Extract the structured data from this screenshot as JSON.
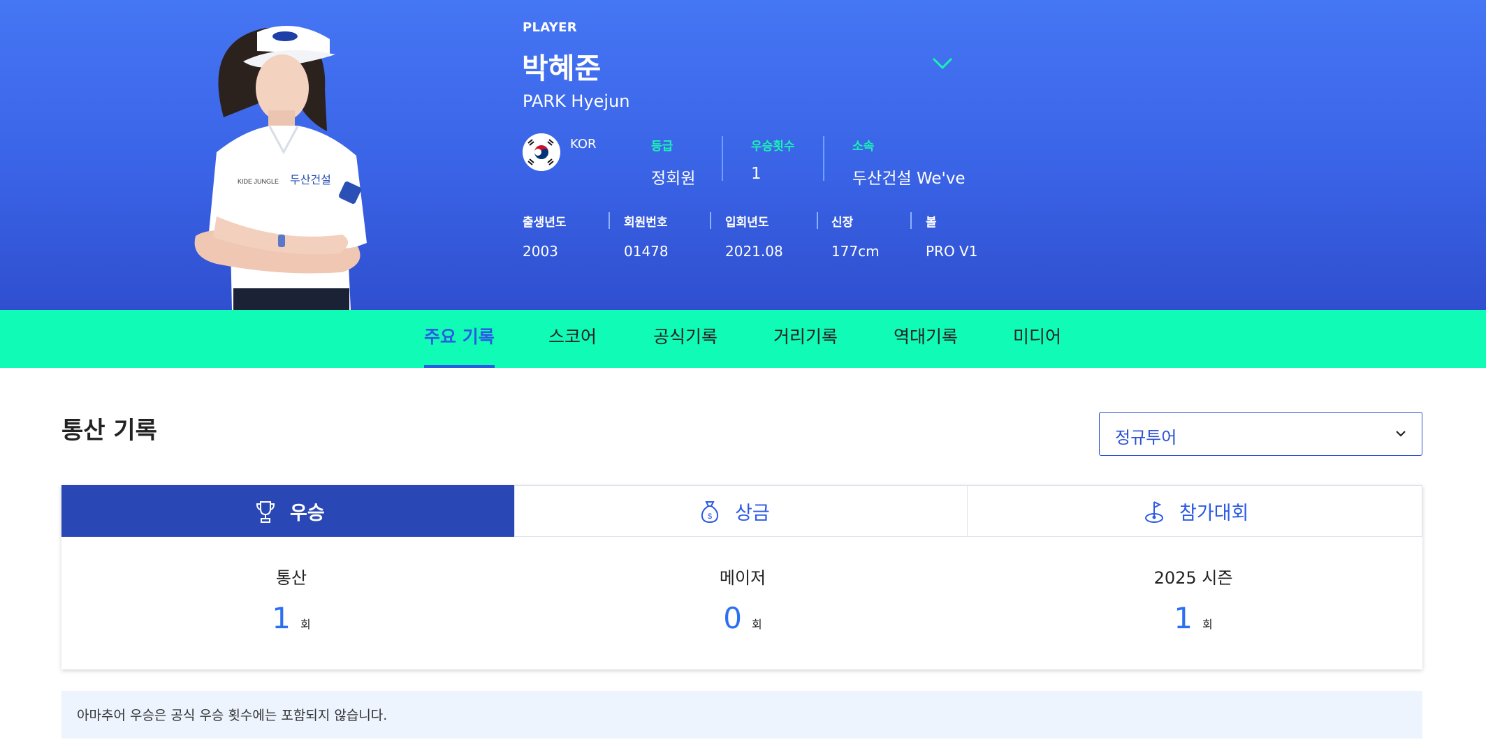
{
  "player": {
    "label": "PLAYER",
    "name_kr": "박혜준",
    "name_en": "PARK Hyejun",
    "nation": "KOR",
    "stats": [
      {
        "label": "등급",
        "value": "정회원"
      },
      {
        "label": "우승횟수",
        "value": "1"
      },
      {
        "label": "소속",
        "value": "두산건설 We've"
      }
    ],
    "details": [
      {
        "label": "출생년도",
        "value": "2003"
      },
      {
        "label": "회원번호",
        "value": "01478"
      },
      {
        "label": "입회년도",
        "value": "2021.08"
      },
      {
        "label": "신장",
        "value": "177cm"
      },
      {
        "label": "볼",
        "value": "PRO V1"
      }
    ],
    "photo_icon": "player-photo",
    "expand_icon": "chevron-down-icon"
  },
  "tabs": [
    {
      "label": "주요 기록",
      "active": true
    },
    {
      "label": "스코어",
      "active": false
    },
    {
      "label": "공식기록",
      "active": false
    },
    {
      "label": "거리기록",
      "active": false
    },
    {
      "label": "역대기록",
      "active": false
    },
    {
      "label": "미디어",
      "active": false
    }
  ],
  "section": {
    "title": "통산 기록",
    "tour_select": "정규투어"
  },
  "record_tabs": [
    {
      "label": "우승",
      "icon": "trophy-icon",
      "active": true
    },
    {
      "label": "상금",
      "icon": "money-bag-icon",
      "active": false
    },
    {
      "label": "참가대회",
      "icon": "golf-flag-icon",
      "active": false
    }
  ],
  "records": [
    {
      "title": "통산",
      "value": "1",
      "unit": "회"
    },
    {
      "title": "메이저",
      "value": "0",
      "unit": "회"
    },
    {
      "title": "2025 시즌",
      "value": "1",
      "unit": "회"
    }
  ],
  "notice": "아마추어 우승은 공식 우승 횟수에는 포함되지 않습니다.",
  "colors": {
    "hero_blue": "#3a63e6",
    "mint": "#10fbb6",
    "accent_blue": "#2b5ae5",
    "active_tab_bg": "#2948b5",
    "number_blue": "#2b6ff2",
    "notice_bg": "#edf4fe"
  }
}
